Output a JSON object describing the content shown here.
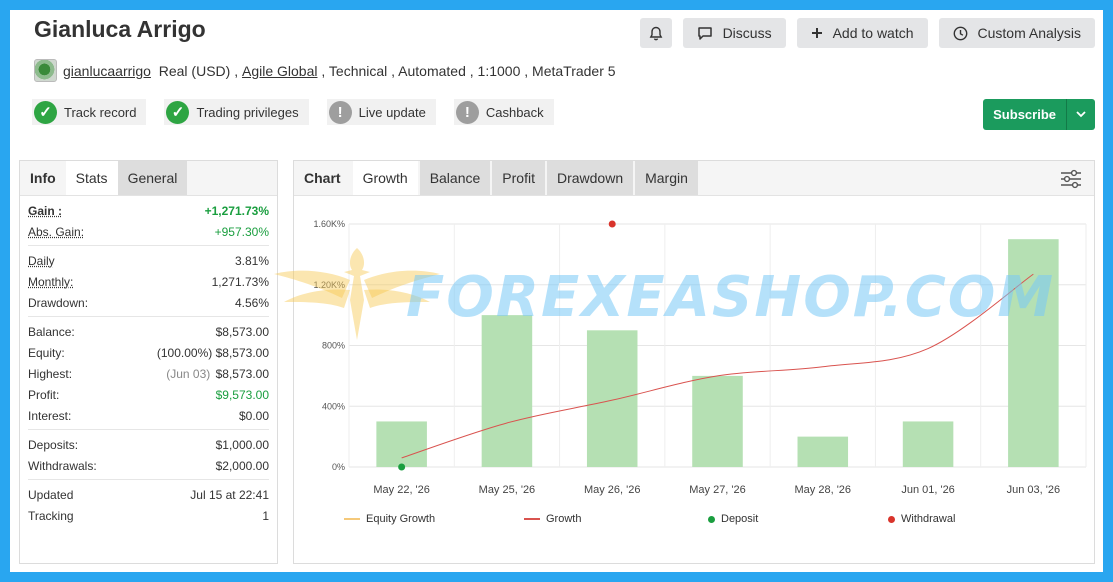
{
  "header": {
    "title": "Gianluca Arrigo",
    "buttons": {
      "discuss": "Discuss",
      "add_to_watch": "Add to watch",
      "custom_analysis": "Custom Analysis"
    }
  },
  "meta": {
    "username": "gianlucaarrigo",
    "account_type": "Real (USD)",
    "broker": "Agile Global",
    "rest": ", Technical , Automated , 1:1000 , MetaTrader 5"
  },
  "badges": [
    {
      "label": "Track record",
      "status": "ok"
    },
    {
      "label": "Trading privileges",
      "status": "ok"
    },
    {
      "label": "Live update",
      "status": "warn"
    },
    {
      "label": "Cashback",
      "status": "warn"
    }
  ],
  "subscribe_label": "Subscribe",
  "left_tabs": [
    "Info",
    "Stats",
    "General"
  ],
  "stats": {
    "gain_label": "Gain :",
    "gain_value": "+1,271.73%",
    "abs_gain_label": "Abs. Gain:",
    "abs_gain_value": "+957.30%",
    "daily_label": "Daily",
    "daily_value": "3.81%",
    "monthly_label": "Monthly:",
    "monthly_value": "1,271.73%",
    "drawdown_label": "Drawdown:",
    "drawdown_value": "4.56%",
    "balance_label": "Balance:",
    "balance_value": "$8,573.00",
    "equity_label": "Equity:",
    "equity_pct": "(100.00%)",
    "equity_value": "$8,573.00",
    "highest_label": "Highest:",
    "highest_date": "(Jun 03)",
    "highest_value": "$8,573.00",
    "profit_label": "Profit:",
    "profit_value": "$9,573.00",
    "interest_label": "Interest:",
    "interest_value": "$0.00",
    "deposits_label": "Deposits:",
    "deposits_value": "$1,000.00",
    "withdrawals_label": "Withdrawals:",
    "withdrawals_value": "$2,000.00",
    "updated_label": "Updated",
    "updated_value": "Jul 15 at 22:41",
    "tracking_label": "Tracking",
    "tracking_value": "1"
  },
  "chart_tabs": {
    "label": "Chart",
    "tabs": [
      "Growth",
      "Balance",
      "Profit",
      "Drawdown",
      "Margin"
    ],
    "active": "Growth"
  },
  "watermark": "FOREXEASHOP.COM",
  "colors": {
    "bar": "#b5e0b3",
    "growth": "#d9534f",
    "equity": "#f5c97a",
    "deposit": "#1a9e3f",
    "withdrawal": "#d9342b",
    "accent": "#1b9b5d"
  },
  "chart_data": {
    "type": "bar",
    "categories": [
      "May 22, '26",
      "May 25, '26",
      "May 26, '26",
      "May 27, '26",
      "May 28, '26",
      "Jun 01, '26",
      "Jun 03, '26"
    ],
    "y_ticks": [
      "0%",
      "400%",
      "800%",
      "1.20K%",
      "1.60K%"
    ],
    "ylim": [
      0,
      1600
    ],
    "series": [
      {
        "name": "Growth",
        "type": "bar",
        "values": [
          300,
          1000,
          900,
          600,
          200,
          300,
          1500
        ]
      },
      {
        "name": "Growth",
        "type": "line",
        "values": [
          60,
          290,
          440,
          600,
          660,
          780,
          1270
        ]
      }
    ],
    "deposit": {
      "category_index": 0,
      "value": 0
    },
    "withdrawal": {
      "category_index": 2,
      "value": 1600
    },
    "legend": [
      "Equity Growth",
      "Growth",
      "Deposit",
      "Withdrawal"
    ]
  }
}
